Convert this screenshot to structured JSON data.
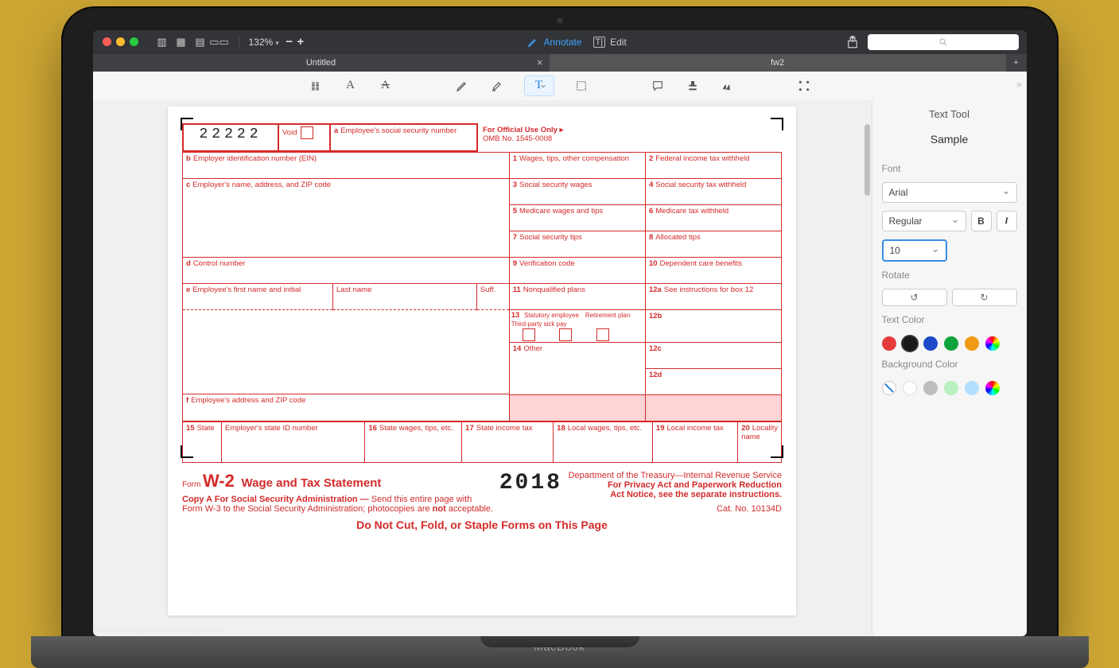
{
  "titlebar": {
    "zoom": "132%",
    "annotate": "Annotate",
    "edit": "Edit"
  },
  "tabs": {
    "t1": "Untitled",
    "t2": "fw2"
  },
  "panel": {
    "title": "Text Tool",
    "sample": "Sample",
    "font_label": "Font",
    "font": "Arial",
    "weight": "Regular",
    "bold": "B",
    "italic": "I",
    "size": "10",
    "rotate_label": "Rotate",
    "textcolor_label": "Text Color",
    "bgcolor_label": "Background Color",
    "text_colors": [
      "#e53b3b",
      "#1a1a1a",
      "#1e49c9",
      "#10a33d",
      "#f09a13",
      "rainbow"
    ],
    "bg_colors": [
      "none",
      "#ffffff",
      "#bdbdbd",
      "#b9f1c0",
      "#b3e0ff",
      "rainbow"
    ]
  },
  "form": {
    "num": "22222",
    "void": "Void",
    "a": "Employee's social security number",
    "official": "For Official Use Only ▸",
    "omb": "OMB No. 1545-0008",
    "b": "Employer identification number (EIN)",
    "c": "Employer's name, address, and ZIP code",
    "d": "Control number",
    "e": "Employee's first name and initial",
    "last": "Last name",
    "suff": "Suff.",
    "f": "Employee's address and ZIP code",
    "box1": "Wages, tips, other compensation",
    "box2": "Federal income tax withheld",
    "box3": "Social security wages",
    "box4": "Social security tax withheld",
    "box5": "Medicare wages and tips",
    "box6": "Medicare tax withheld",
    "box7": "Social security tips",
    "box8": "Allocated tips",
    "box9": "Verification code",
    "box10": "Dependent care benefits",
    "box11": "Nonqualified plans",
    "box12a": "See instructions for box 12",
    "box12b": "12b",
    "box12c": "12c",
    "box12d": "12d",
    "stat": "Statutory employee",
    "ret": "Retirement plan",
    "tp": "Third-party sick pay",
    "box14": "Other",
    "box15": "State",
    "box15b": "Employer's state ID number",
    "box16": "State wages, tips, etc.",
    "box17": "State income tax",
    "box18": "Local wages, tips, etc.",
    "box19": "Local income tax",
    "box20": "Locality name",
    "form_label": "Form",
    "w2": "W-2",
    "subtitle": "Wage and Tax Statement",
    "year": "2018",
    "dept": "Department of the Treasury—Internal Revenue Service",
    "priv": "For Privacy Act and Paperwork Reduction",
    "priv2": "Act Notice, see the separate instructions.",
    "copyA": "Copy A For Social Security Administration —",
    "copyA2": "Send this entire page with",
    "copyA3": "Form W-3 to the Social Security Administration; photocopies are",
    "copyA3b": "not",
    "copyA3c": "acceptable.",
    "cat": "Cat. No. 10134D",
    "donot": "Do Not Cut, Fold, or Staple Forms on This Page"
  },
  "mac": "MacBook",
  "watermark": "www.heritagechristiancollege.com"
}
